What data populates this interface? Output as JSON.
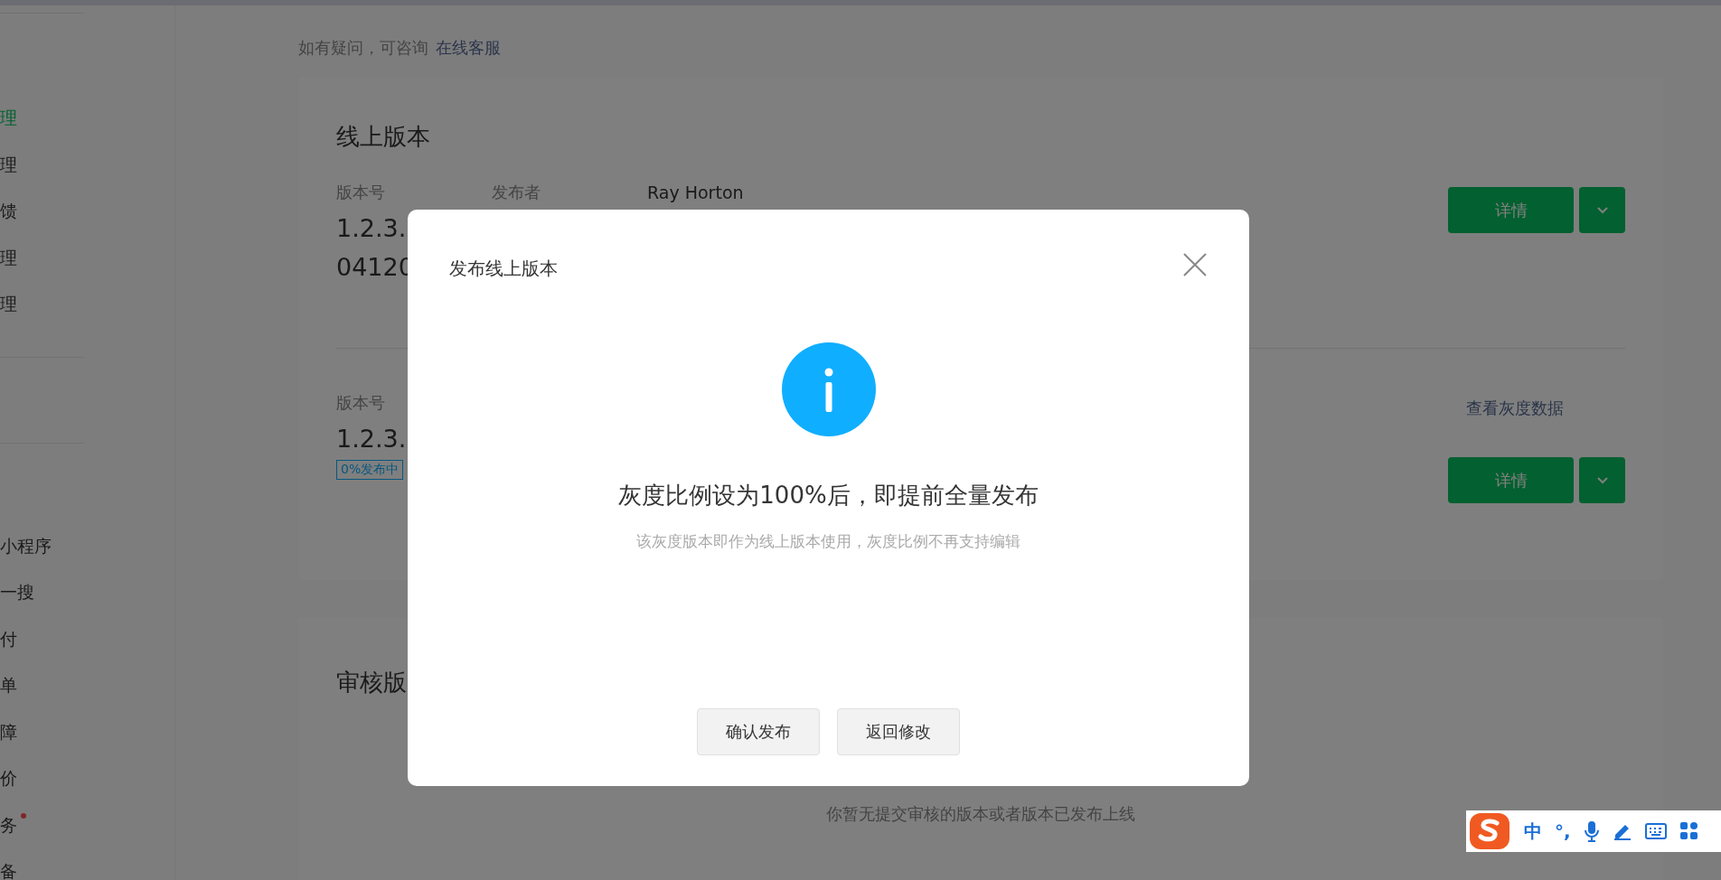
{
  "sidebar": {
    "groups": [
      {
        "items": [
          {
            "label": "理",
            "selected": true,
            "dot": false
          },
          {
            "label": "理",
            "selected": false,
            "dot": false
          },
          {
            "label": "馈",
            "selected": false,
            "dot": false
          },
          {
            "label": "理",
            "selected": false,
            "dot": false
          },
          {
            "label": "理",
            "selected": false,
            "dot": false
          }
        ]
      },
      {
        "items": [
          {
            "label": "小程序",
            "selected": false,
            "dot": false
          },
          {
            "label": "一搜",
            "selected": false,
            "dot": false
          },
          {
            "label": "付",
            "selected": false,
            "dot": false
          },
          {
            "label": "单",
            "selected": false,
            "dot": false
          },
          {
            "label": "障",
            "selected": false,
            "dot": false
          },
          {
            "label": "价",
            "selected": false,
            "dot": false
          },
          {
            "label": "务",
            "selected": false,
            "dot": true
          },
          {
            "label": "备",
            "selected": false,
            "dot": false
          }
        ]
      }
    ]
  },
  "top_note": {
    "text": "如有疑问，可咨询",
    "link": "在线客服"
  },
  "online_card": {
    "title": "线上版本",
    "versions": [
      {
        "kind": "live",
        "number_label": "版本号",
        "number": "1.2.3.",
        "publisher_label": "发布者",
        "publisher": "Ray Horton",
        "line_2": "04120",
        "button": "详情"
      },
      {
        "kind": "gray",
        "number_label": "版本号",
        "number": "1.2.3.",
        "tag": "0%发布中",
        "link": "查看灰度数据",
        "button": "详情"
      }
    ]
  },
  "review_card": {
    "title": "审核版",
    "empty_text": "你暂无提交审核的版本或者版本已发布上线"
  },
  "dialog": {
    "title": "发布线上版本",
    "heading": "灰度比例设为100%后，即提前全量发布",
    "description": "该灰度版本即作为线上版本使用，灰度比例不再支持编辑",
    "buttons": [
      "确认发布",
      "返回修改"
    ]
  },
  "ime_toolbar": {
    "mode": "中",
    "punctuation": "°,"
  }
}
